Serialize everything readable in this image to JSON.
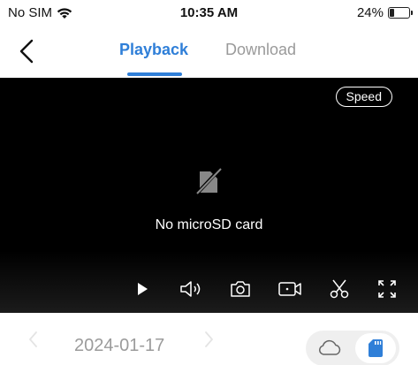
{
  "status_bar": {
    "carrier": "No SIM",
    "time": "10:35 AM",
    "battery_text": "24%",
    "battery_level": 0.24
  },
  "header": {
    "tabs": [
      {
        "label": "Playback",
        "active": true
      },
      {
        "label": "Download",
        "active": false
      }
    ]
  },
  "player": {
    "speed_label": "Speed",
    "empty_message": "No microSD card",
    "controls": [
      "play-icon",
      "volume-icon",
      "camera-icon",
      "record-icon",
      "scissors-icon",
      "fullscreen-icon"
    ]
  },
  "date_bar": {
    "date": "2024-01-17",
    "storage_options": [
      "cloud-icon",
      "sd-card-icon"
    ],
    "selected_storage": "sd-card-icon"
  },
  "colors": {
    "accent": "#2f7fd8",
    "video_bg": "#000000",
    "inactive_text": "#9a9a9a"
  }
}
